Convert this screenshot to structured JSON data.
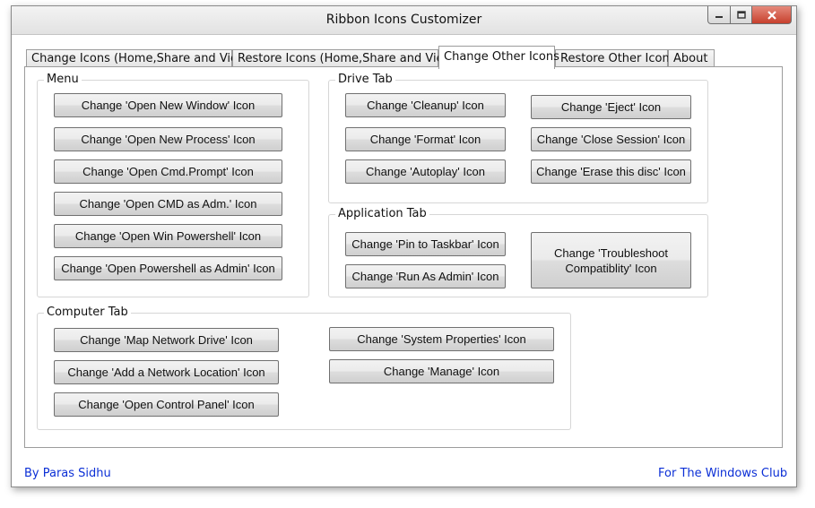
{
  "window": {
    "title": "Ribbon Icons Customizer"
  },
  "tabs": [
    {
      "label": "Change Icons (Home,Share and View)"
    },
    {
      "label": "Restore Icons (Home,Share and View)"
    },
    {
      "label": "Change Other Icons"
    },
    {
      "label": "Restore Other Icons"
    },
    {
      "label": "About"
    }
  ],
  "menu": {
    "title": "Menu",
    "buttons": [
      "Change 'Open New Window' Icon",
      "Change 'Open New Process' Icon",
      "Change 'Open Cmd.Prompt' Icon",
      "Change 'Open CMD as Adm.' Icon",
      "Change 'Open Win Powershell' Icon",
      "Change 'Open Powershell as Admin' Icon"
    ]
  },
  "drive_tab": {
    "title": "Drive Tab",
    "buttons": [
      "Change 'Cleanup' Icon",
      "Change 'Format' Icon",
      "Change 'Autoplay' Icon",
      "Change 'Eject' Icon",
      "Change 'Close Session' Icon",
      "Change 'Erase this disc' Icon"
    ]
  },
  "application_tab": {
    "title": "Application Tab",
    "buttons": [
      "Change 'Pin to Taskbar' Icon",
      "Change 'Run As Admin' Icon",
      "Change 'Troubleshoot Compatiblity' Icon"
    ]
  },
  "computer_tab": {
    "title": "Computer Tab",
    "buttons": [
      "Change 'Map Network Drive' Icon",
      "Change 'Add a Network Location' Icon",
      "Change 'Open Control Panel' Icon",
      "Change 'System Properties' Icon",
      "Change 'Manage' Icon"
    ]
  },
  "footer": {
    "author": "By Paras Sidhu",
    "club": "For The Windows Club"
  },
  "colors": {
    "link": "#0b2fd6",
    "close_button": "#c7402d"
  },
  "icons": [
    "minimize-icon",
    "maximize-icon",
    "close-icon"
  ]
}
